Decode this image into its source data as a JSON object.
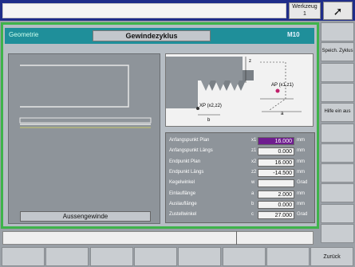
{
  "top": {
    "tool_label": "Werkzeug",
    "tool_value": "1",
    "cursor_icon": "pointer-cursor-icon"
  },
  "header": {
    "left": "Geometrie",
    "title": "Gewindezyklus",
    "right": "M10"
  },
  "left_panel": {
    "button_label": "Aussengewinde"
  },
  "diagram": {
    "label_z": "z",
    "label_a": "a",
    "label_xp": "XP (x2,z2)",
    "label_ap": "AP (x1,z1)",
    "label_b": "b"
  },
  "params": [
    {
      "label": "Anfangspunkt Plan",
      "var": "x1",
      "value": "16.000",
      "unit": "mm",
      "active": true
    },
    {
      "label": "Anfangspunkt Längs",
      "var": "z1",
      "value": "0.000",
      "unit": "mm",
      "active": false
    },
    {
      "label": "Endpunkt Plan",
      "var": "x2",
      "value": "16.000",
      "unit": "mm",
      "active": false
    },
    {
      "label": "Endpunkt Längs",
      "var": "z2",
      "value": "-14.500",
      "unit": "mm",
      "active": false
    },
    {
      "label": "Kegelwinkel",
      "var": "w",
      "value": "",
      "unit": "Grad",
      "active": false
    },
    {
      "label": "Einlauflänge",
      "var": "a",
      "value": "2.000",
      "unit": "mm",
      "active": false
    },
    {
      "label": "Auslauflänge",
      "var": "b",
      "value": "0.000",
      "unit": "mm",
      "active": false
    },
    {
      "label": "Zustellwinkel",
      "var": "c",
      "value": "27.000",
      "unit": "Grad",
      "active": false
    }
  ],
  "softkeys_right": [
    "",
    "Speich. Zyklus",
    "",
    "",
    "Hilfe ein aus",
    "",
    "",
    "",
    "",
    "",
    ""
  ],
  "softkeys_bottom": [
    "",
    "",
    "",
    "",
    "",
    "",
    "",
    "Zurück"
  ]
}
